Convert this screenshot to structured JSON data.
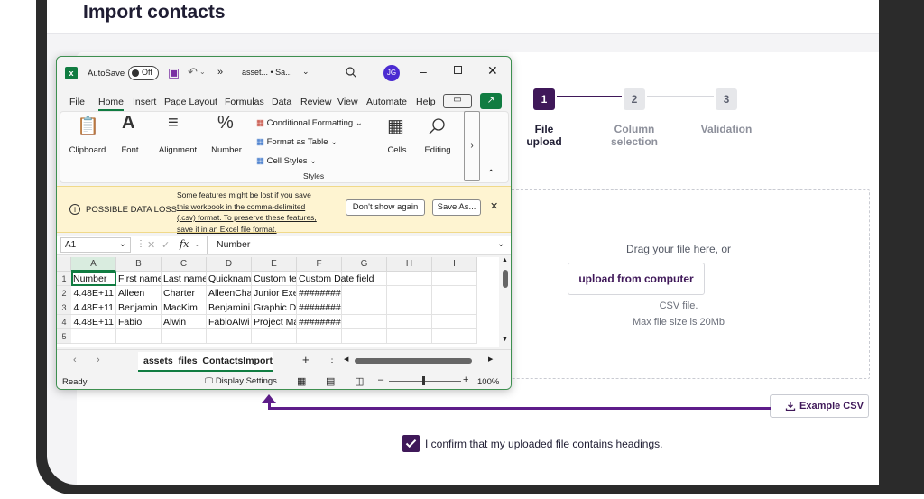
{
  "page": {
    "title": "Import contacts"
  },
  "stepper": {
    "steps": [
      {
        "number": "1",
        "label_line1": "File",
        "label_line2": "upload"
      },
      {
        "number": "2",
        "label_line1": "Column",
        "label_line2": "selection"
      },
      {
        "number": "3",
        "label_line1": "Validation",
        "label_line2": ""
      }
    ]
  },
  "upload": {
    "drag_text": "Drag your file here, or",
    "button_label": "upload from computer",
    "file_type_text": "CSV file.",
    "max_size_text": "Max file size is 20Mb"
  },
  "example_csv": {
    "label": "Example CSV"
  },
  "confirm": {
    "label": "I confirm that my uploaded file contains headings.",
    "checked": true
  },
  "excel": {
    "autosave_label": "AutoSave",
    "autosave_state": "Off",
    "more_glyph": "»",
    "filename": "asset... • Sa...",
    "avatar_initials": "JG",
    "ribbon_tabs": [
      "File",
      "Home",
      "Insert",
      "Page Layout",
      "Formulas",
      "Data",
      "Review",
      "View",
      "Automate",
      "Help"
    ],
    "ribbon_groups": {
      "clipboard": "Clipboard",
      "font": "Font",
      "alignment": "Alignment",
      "number": "Number",
      "cond_format": "Conditional Formatting",
      "format_table": "Format as Table",
      "cell_styles": "Cell Styles",
      "styles": "Styles",
      "cells": "Cells",
      "editing": "Editing"
    },
    "warning": {
      "title": "POSSIBLE DATA LOSS",
      "message_lines": [
        "Some features might be lost if you save",
        "this workbook in the comma-delimited",
        "(.csv) format. To preserve these features,",
        "save it in an Excel file format."
      ],
      "dont_show": "Don't show again",
      "save_as": "Save As..."
    },
    "name_box": "A1",
    "formula_value": "Number",
    "fx": "fx",
    "columns": [
      "A",
      "B",
      "C",
      "D",
      "E",
      "F",
      "G",
      "H",
      "I"
    ],
    "rows": [
      {
        "n": "1",
        "cells": [
          "Number",
          "First name",
          "Last name",
          "Quicknam",
          "Custom te",
          "Custom Date field",
          "",
          "",
          ""
        ]
      },
      {
        "n": "2",
        "cells": [
          "4.48E+11",
          "Alleen",
          "Charter",
          "AlleenCha",
          "Junior Exe",
          "########",
          "",
          "",
          ""
        ]
      },
      {
        "n": "3",
        "cells": [
          "4.48E+11",
          "Benjamin",
          "MacKim",
          "Benjamini",
          "Graphic D",
          "########",
          "",
          "",
          ""
        ]
      },
      {
        "n": "4",
        "cells": [
          "4.48E+11",
          "Fabio",
          "Alwin",
          "FabioAlwi",
          "Project Ma",
          "########",
          "",
          "",
          ""
        ]
      },
      {
        "n": "5",
        "cells": [
          "",
          "",
          "",
          "",
          "",
          "",
          "",
          "",
          ""
        ]
      }
    ],
    "sheet_tab": "assets_files_ContactsImportEx",
    "status_ready": "Ready",
    "display_settings": "Display Settings",
    "zoom": "100%"
  },
  "colors": {
    "brand": "#3f1859",
    "arrow": "#5e1d8a",
    "excel_green": "#107c41"
  }
}
